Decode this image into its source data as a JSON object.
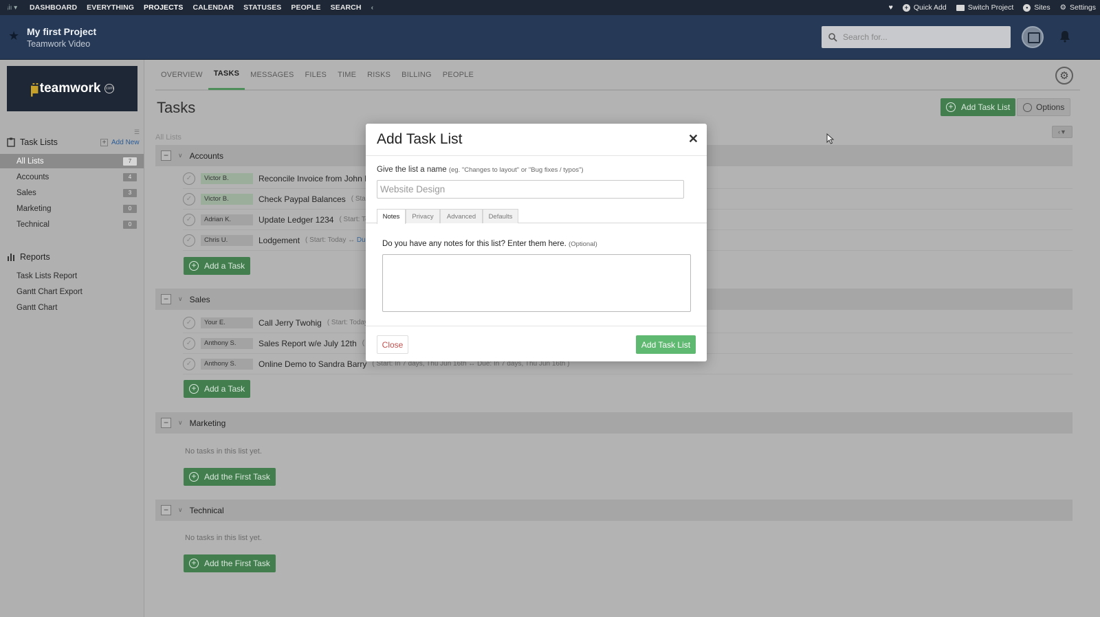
{
  "topnav": {
    "items": [
      "DASHBOARD",
      "EVERYTHING",
      "PROJECTS",
      "CALENDAR",
      "STATUSES",
      "PEOPLE",
      "SEARCH"
    ],
    "active": "PROJECTS",
    "quick_add": "Quick Add",
    "switch_project": "Switch Project",
    "sites": "Sites",
    "settings": "Settings"
  },
  "project": {
    "title": "My first Project",
    "subtitle": "Teamwork Video",
    "search_placeholder": "Search for..."
  },
  "sidebar": {
    "brand": "teamwork",
    "task_lists_heading": "Task Lists",
    "add_new": "Add New",
    "lists": [
      {
        "label": "All Lists",
        "count": "7"
      },
      {
        "label": "Accounts",
        "count": "4"
      },
      {
        "label": "Sales",
        "count": "3"
      },
      {
        "label": "Marketing",
        "count": "0"
      },
      {
        "label": "Technical",
        "count": "0"
      }
    ],
    "reports_heading": "Reports",
    "reports": [
      "Task Lists Report",
      "Gantt Chart Export",
      "Gantt Chart"
    ]
  },
  "main": {
    "tabs": [
      "OVERVIEW",
      "TASKS",
      "MESSAGES",
      "FILES",
      "TIME",
      "RISKS",
      "BILLING",
      "PEOPLE"
    ],
    "active_tab": "TASKS",
    "title": "Tasks",
    "add_task_list": "Add Task List",
    "options": "Options",
    "all_lists": "All Lists",
    "add_a_task": "Add a Task",
    "add_first_task": "Add the First Task",
    "no_tasks": "No tasks in this list yet.",
    "groups": {
      "accounts": {
        "name": "Accounts",
        "tasks": [
          {
            "assignee": "Victor B.",
            "name": "Reconcile Invoice from John Blo",
            "meta": ""
          },
          {
            "assignee": "Victor B.",
            "name": "Check Paypal Balances",
            "meta": "( Start:"
          },
          {
            "assignee": "Adrian K.",
            "name": "Update Ledger 1234",
            "meta": "( Start: To"
          },
          {
            "assignee": "Chris U.",
            "name": "Lodgement",
            "meta": "( Start: Today ↔",
            "meta_link": "Due"
          }
        ]
      },
      "sales": {
        "name": "Sales",
        "tasks": [
          {
            "assignee": "Your E.",
            "name": "Call Jerry Twohig",
            "meta": "( Start: Today"
          },
          {
            "assignee": "Anthony S.",
            "name": "Sales Report w/e July 12th",
            "meta": "( St"
          },
          {
            "assignee": "Anthony S.",
            "name": "Online Demo to Sandra Barry",
            "meta": "( Start: In 7 days, Thu Jun 16th ↔ Due: In 7 days, Thu Jun 16th )"
          }
        ]
      },
      "marketing": {
        "name": "Marketing"
      },
      "technical": {
        "name": "Technical"
      }
    }
  },
  "modal": {
    "title": "Add Task List",
    "name_label": "Give the list a name",
    "name_hint": "(eg. \"Changes to layout\" or \"Bug fixes / typos\")",
    "name_value": "Website Design",
    "tabs": [
      "Notes",
      "Privacy",
      "Advanced",
      "Defaults"
    ],
    "active_tab": "Notes",
    "notes_label": "Do you have any notes for this list? Enter them here.",
    "notes_optional": "(Optional)",
    "close": "Close",
    "submit": "Add Task List"
  },
  "colors": {
    "topnav_bg": "#1e2735",
    "header_bg": "#263a57",
    "primary_green": "#5fb971",
    "close_red": "#c0504d"
  }
}
